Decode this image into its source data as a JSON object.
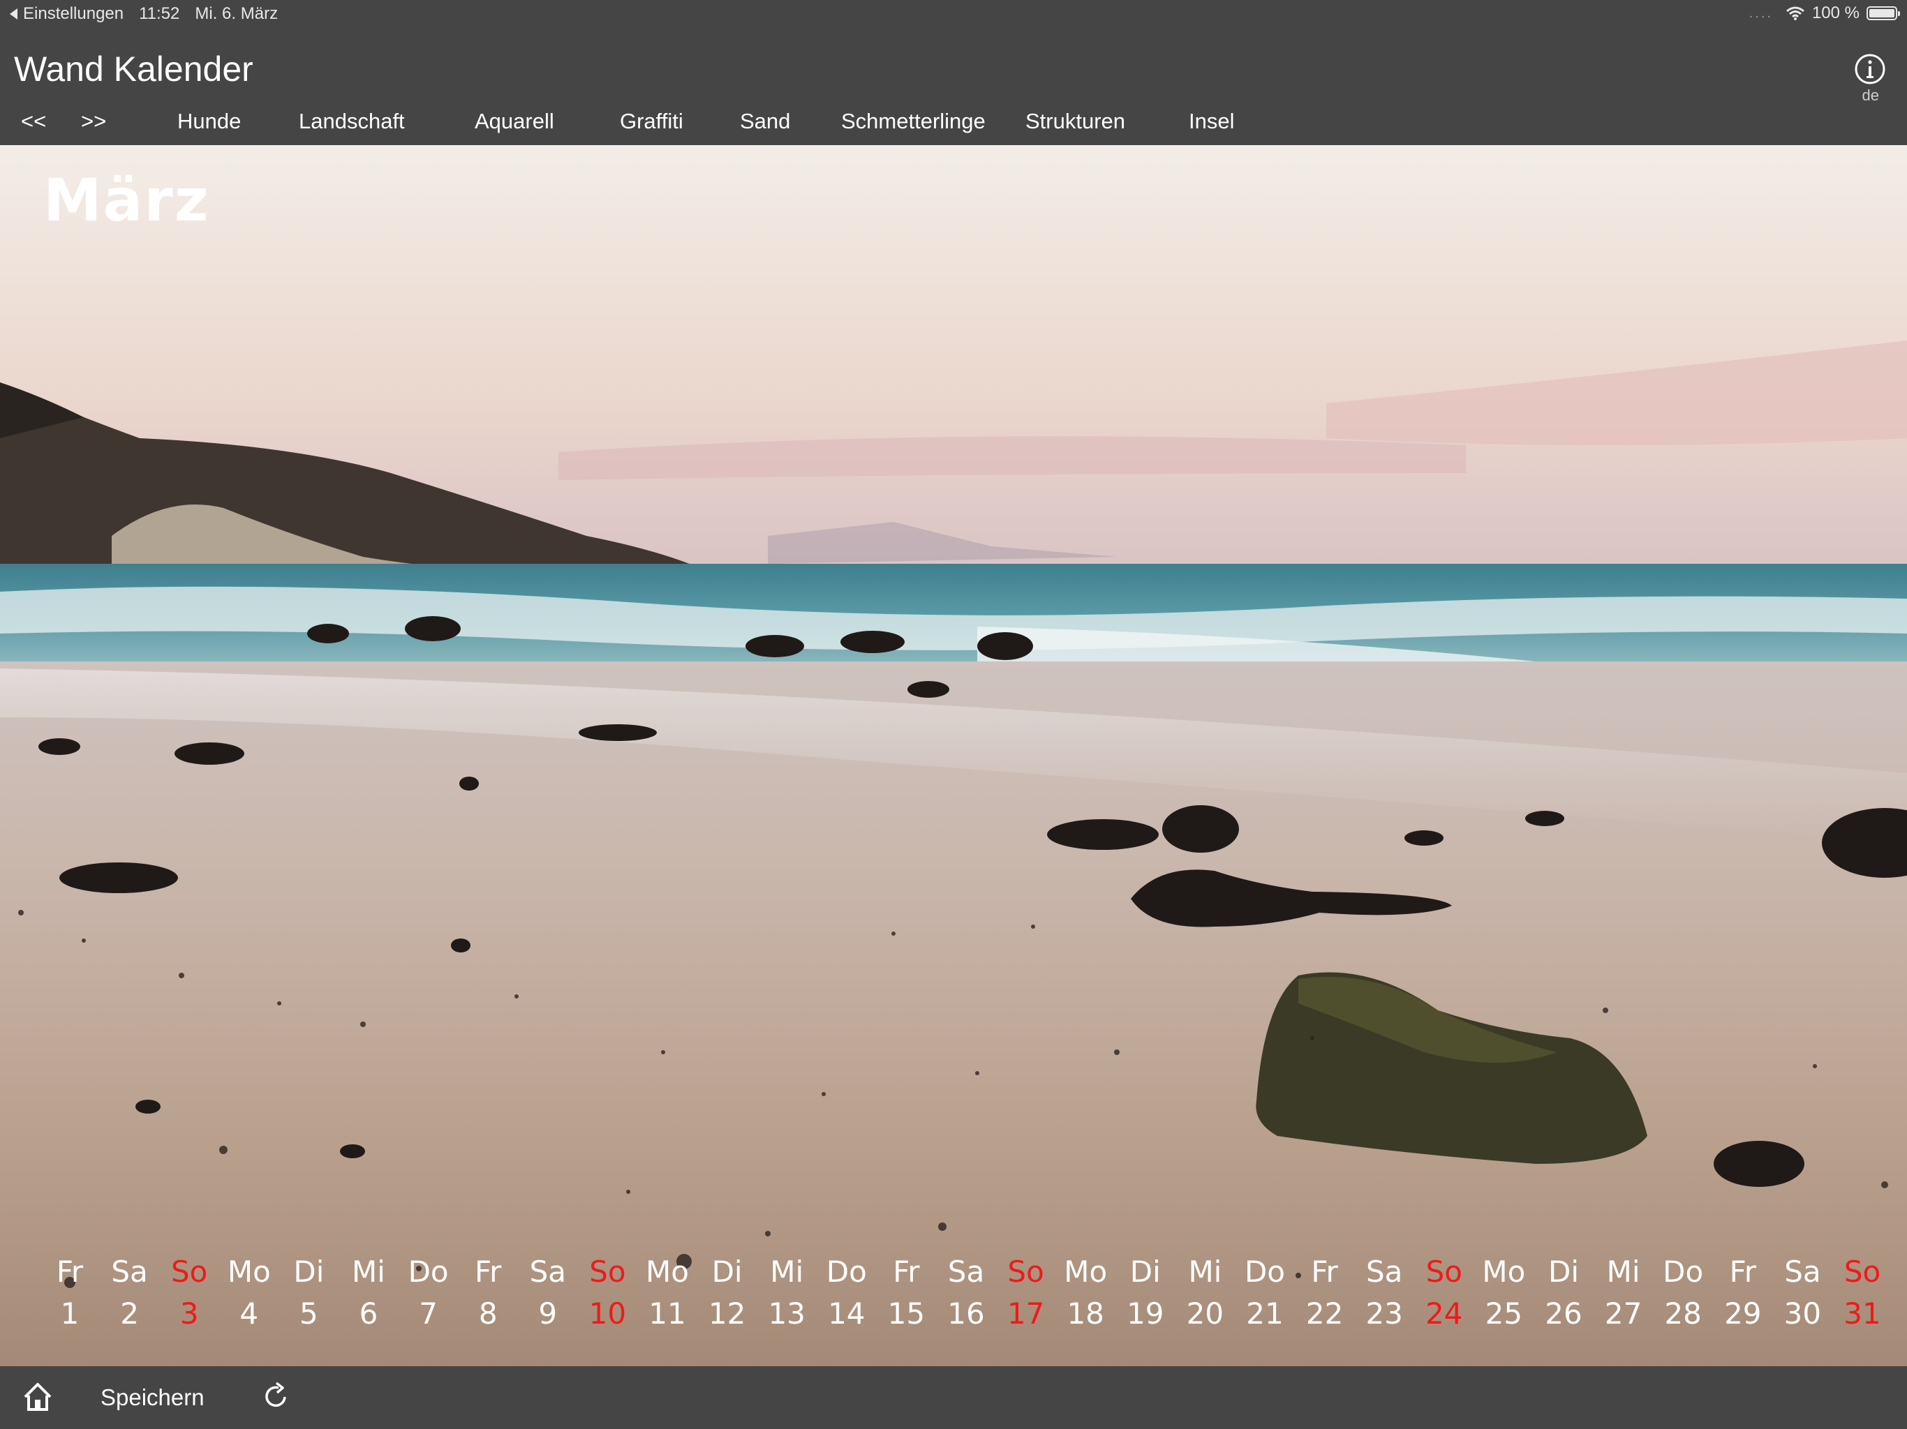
{
  "status_bar": {
    "back_label": "Einstellungen",
    "time": "11:52",
    "date": "Mi. 6. März",
    "battery": "100 %",
    "battery_level": 1.0
  },
  "header": {
    "title": "Wand Kalender",
    "lang": "de",
    "nav": {
      "prev": "<<",
      "next": ">>",
      "categories": [
        "Hunde",
        "Landschaft",
        "Aquarell",
        "Graffiti",
        "Sand",
        "Schmetterlinge",
        "Strukturen",
        "Insel"
      ]
    }
  },
  "calendar": {
    "month": "März",
    "days": [
      {
        "wd": "Fr",
        "d": "1",
        "sun": false
      },
      {
        "wd": "Sa",
        "d": "2",
        "sun": false
      },
      {
        "wd": "So",
        "d": "3",
        "sun": true
      },
      {
        "wd": "Mo",
        "d": "4",
        "sun": false
      },
      {
        "wd": "Di",
        "d": "5",
        "sun": false
      },
      {
        "wd": "Mi",
        "d": "6",
        "sun": false
      },
      {
        "wd": "Do",
        "d": "7",
        "sun": false
      },
      {
        "wd": "Fr",
        "d": "8",
        "sun": false
      },
      {
        "wd": "Sa",
        "d": "9",
        "sun": false
      },
      {
        "wd": "So",
        "d": "10",
        "sun": true
      },
      {
        "wd": "Mo",
        "d": "11",
        "sun": false
      },
      {
        "wd": "Di",
        "d": "12",
        "sun": false
      },
      {
        "wd": "Mi",
        "d": "13",
        "sun": false
      },
      {
        "wd": "Do",
        "d": "14",
        "sun": false
      },
      {
        "wd": "Fr",
        "d": "15",
        "sun": false
      },
      {
        "wd": "Sa",
        "d": "16",
        "sun": false
      },
      {
        "wd": "So",
        "d": "17",
        "sun": true
      },
      {
        "wd": "Mo",
        "d": "18",
        "sun": false
      },
      {
        "wd": "Di",
        "d": "19",
        "sun": false
      },
      {
        "wd": "Mi",
        "d": "20",
        "sun": false
      },
      {
        "wd": "Do",
        "d": "21",
        "sun": false
      },
      {
        "wd": "Fr",
        "d": "22",
        "sun": false
      },
      {
        "wd": "Sa",
        "d": "23",
        "sun": false
      },
      {
        "wd": "So",
        "d": "24",
        "sun": true
      },
      {
        "wd": "Mo",
        "d": "25",
        "sun": false
      },
      {
        "wd": "Di",
        "d": "26",
        "sun": false
      },
      {
        "wd": "Mi",
        "d": "27",
        "sun": false
      },
      {
        "wd": "Do",
        "d": "28",
        "sun": false
      },
      {
        "wd": "Fr",
        "d": "29",
        "sun": false
      },
      {
        "wd": "Sa",
        "d": "30",
        "sun": false
      },
      {
        "wd": "So",
        "d": "31",
        "sun": true
      }
    ]
  },
  "toolbar": {
    "home_icon": "home-icon",
    "save_label": "Speichern",
    "reload_icon": "reload-icon"
  },
  "colors": {
    "bar_bg": "#454545",
    "sunday_red": "#ee1a1a"
  }
}
